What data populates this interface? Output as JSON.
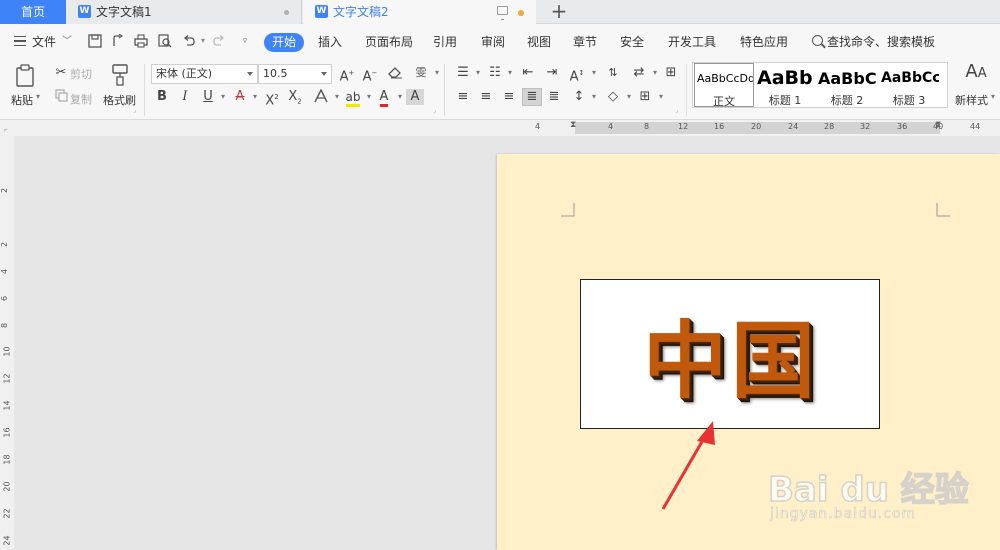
{
  "tabs": {
    "home": "首页",
    "doc1": "文字文稿1",
    "doc2": "文字文稿2",
    "doc_icon_letter": "W"
  },
  "menu": {
    "file": "文件",
    "items": [
      "开始",
      "插入",
      "页面布局",
      "引用",
      "审阅",
      "视图",
      "章节",
      "安全",
      "开发工具",
      "特色应用"
    ],
    "search": "查找命令、搜索模板"
  },
  "ribbon": {
    "paste": "粘贴",
    "cut": "剪切",
    "copy": "复制",
    "format_painter": "格式刷",
    "font_name": "宋体 (正文)",
    "font_size": "10.5",
    "styles": [
      {
        "sample": "AaBbCcDd",
        "name": "正文"
      },
      {
        "sample": "AaBb",
        "name": "标题 1"
      },
      {
        "sample": "AaBbC",
        "name": "标题 2"
      },
      {
        "sample": "AaBbCc",
        "name": "标题 3"
      }
    ],
    "new_style": "新样式"
  },
  "ruler": {
    "h_numbers": [
      "4",
      "4",
      "8",
      "12",
      "16",
      "20",
      "24",
      "28",
      "32",
      "36",
      "40",
      "44"
    ],
    "v_numbers": [
      "2",
      "2",
      "4",
      "6",
      "8",
      "10",
      "12",
      "14",
      "16",
      "18",
      "20",
      "22",
      "24"
    ]
  },
  "document": {
    "textbox_text": "中国",
    "text_color": "#c0590c",
    "page_color": "#fff0c9"
  },
  "watermark": {
    "main": "Bai du 经验",
    "sub": "jingyan.baidu.com"
  },
  "colors": {
    "accent": "#3e83f7",
    "arrow": "#e83232"
  }
}
